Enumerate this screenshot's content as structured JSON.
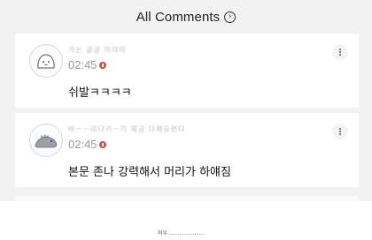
{
  "header": {
    "title": "All Comments",
    "chevron_icon": "chevron-right-circle-icon"
  },
  "comments": [
    {
      "avatar": "blob-face-avatar",
      "username_blurred": "가는 글글 미미미",
      "time": "02:45",
      "new_badge": "N",
      "text": "쉬발ㅋㅋㅋㅋ",
      "more_icon": "more-vertical-icon"
    },
    {
      "avatar": "dinosaur-avatar",
      "username_blurred": "바ㅡㅡ미다기ㅡ기 제금 다제요먼다",
      "time": "02:45",
      "new_badge": "N",
      "text": "본문 존나 강력해서 머리가 하얘짐",
      "more_icon": "more-vertical-icon"
    }
  ],
  "footer": {
    "caption": "와우......................"
  },
  "colors": {
    "badge_red": "#e14a3a",
    "background": "#f2f2f2"
  }
}
